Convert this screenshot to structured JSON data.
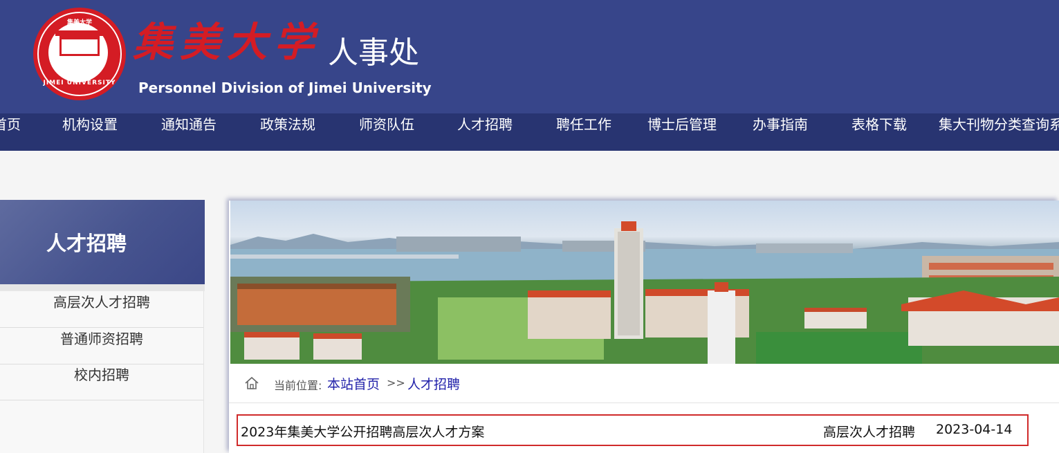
{
  "header": {
    "brand_cn": "集美大学",
    "dept_cn": "人事处",
    "brand_en": "Personnel Division of Jimei University",
    "seal_text": "JIMEI UNIVERSITY",
    "seal_top_text": "集美大学"
  },
  "nav": {
    "items": [
      {
        "label": "首页"
      },
      {
        "label": "机构设置"
      },
      {
        "label": "通知通告"
      },
      {
        "label": "政策法规"
      },
      {
        "label": "师资队伍"
      },
      {
        "label": "人才招聘"
      },
      {
        "label": "聘任工作"
      },
      {
        "label": "博士后管理"
      },
      {
        "label": "办事指南"
      },
      {
        "label": "表格下载"
      },
      {
        "label": "集大刊物分类查询系"
      }
    ]
  },
  "sidebar": {
    "title": "人才招聘",
    "items": [
      {
        "label": "高层次人才招聘"
      },
      {
        "label": "普通师资招聘"
      },
      {
        "label": "校内招聘"
      }
    ]
  },
  "breadcrumb": {
    "label": "当前位置:",
    "home": "本站首页",
    "separator": ">>",
    "current": "人才招聘"
  },
  "list": {
    "rows": [
      {
        "title": "2023年集美大学公开招聘高层次人才方案",
        "category": "高层次人才招聘",
        "date": "2023-04-14"
      }
    ]
  },
  "colors": {
    "header_bg": "#37458a",
    "nav_bg": "#283471",
    "brand_red": "#d41c24",
    "link_blue": "#2222aa",
    "highlight_border": "#d02a2a"
  },
  "icons": {
    "breadcrumb": "home-icon",
    "logo": "university-seal-icon"
  }
}
